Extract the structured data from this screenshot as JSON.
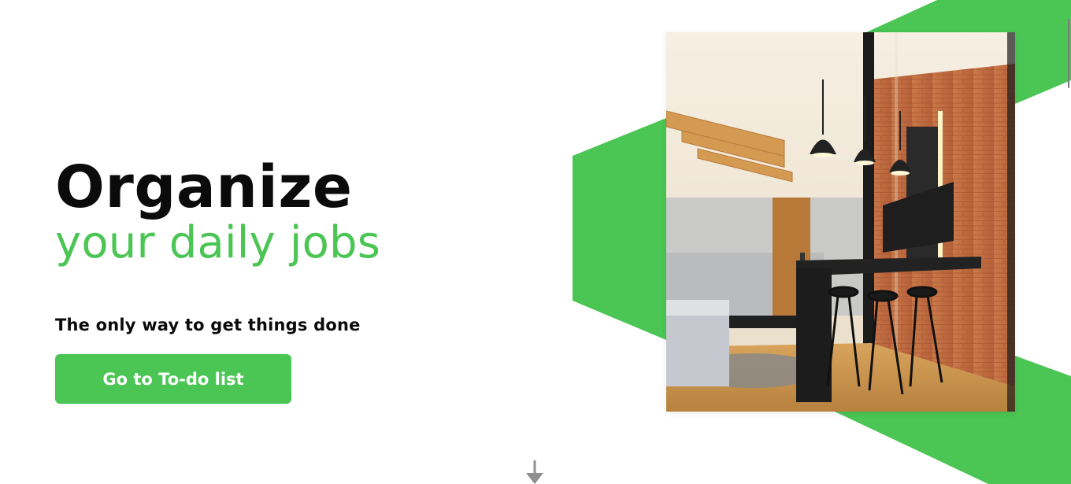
{
  "hero": {
    "title": "Organize",
    "subtitle": "your daily jobs",
    "tagline": "The only way to get things done",
    "cta_label": "Go to To-do list"
  },
  "colors": {
    "accent": "#4bc554",
    "text": "#0b0b0b"
  },
  "icons": {
    "scroll": "arrow-down-icon"
  }
}
